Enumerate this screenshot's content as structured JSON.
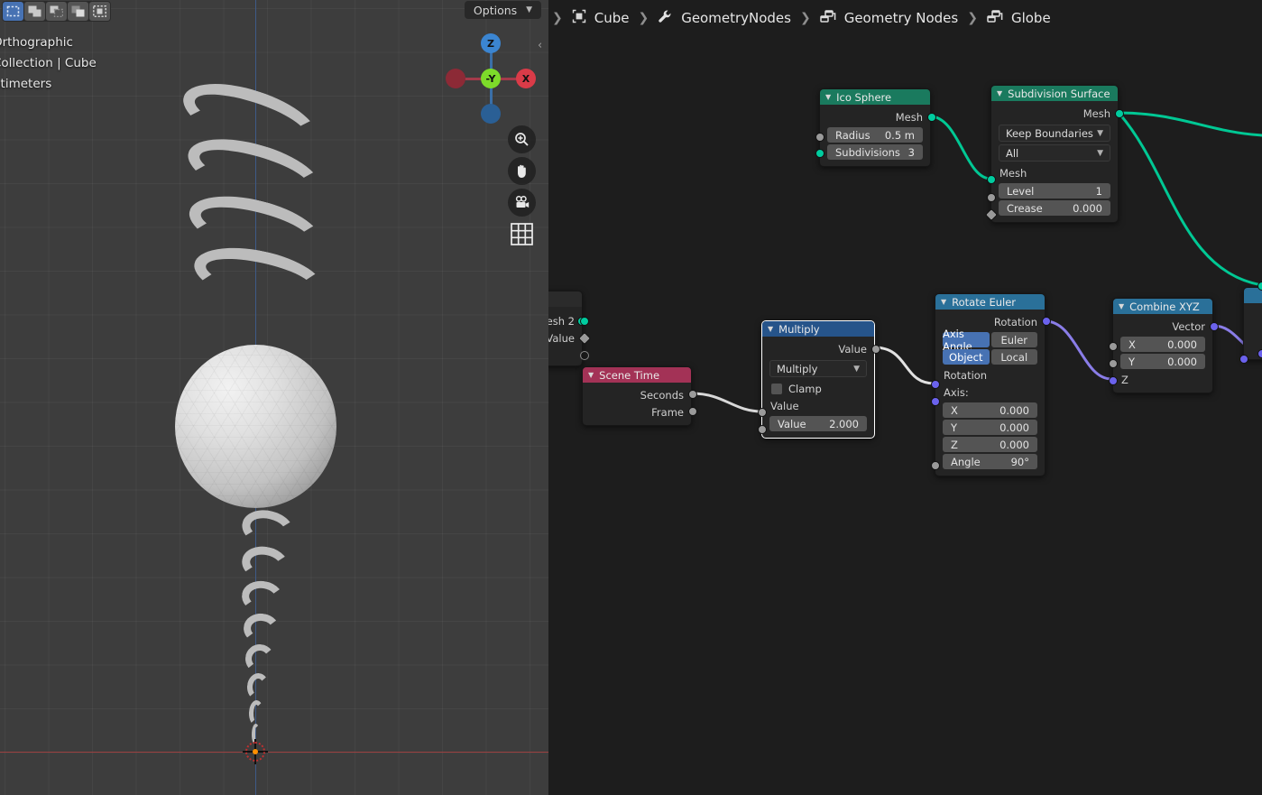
{
  "app": "Blender Geometry Nodes",
  "viewport": {
    "select_modes": [
      {
        "name": "set",
        "active": true
      },
      {
        "name": "extend",
        "active": false
      },
      {
        "name": "subtract",
        "active": false
      },
      {
        "name": "invert",
        "active": false
      },
      {
        "name": "intersect",
        "active": false
      }
    ],
    "options_label": "Options",
    "overlay": {
      "line1": "Orthographic",
      "line2": "Collection | Cube",
      "line3": "ntimeters"
    },
    "gizmo": {
      "z": "Z",
      "y": "-Y",
      "x": "X"
    },
    "tools": [
      {
        "name": "zoom-icon"
      },
      {
        "name": "pan-hand-icon"
      },
      {
        "name": "camera-icon"
      },
      {
        "name": "grid-icon"
      }
    ]
  },
  "breadcrumb": [
    {
      "icon": "object-icon",
      "label": "Cube"
    },
    {
      "icon": "modifier-wrench-icon",
      "label": "GeometryNodes"
    },
    {
      "icon": "nodetree-icon",
      "label": "Geometry Nodes"
    },
    {
      "icon": "nodetree-icon",
      "label": "Globe"
    }
  ],
  "node_editor": {
    "nodes": [
      {
        "id": "clipped-group",
        "title": "",
        "header_color": "#2b2b2b",
        "outputs": [
          {
            "label": "esh 2",
            "type": "geo"
          },
          {
            "label": "Value",
            "type": "diamond"
          },
          {
            "label": "",
            "type": "hollow"
          }
        ]
      },
      {
        "id": "ico-sphere",
        "title": "Ico Sphere",
        "header_color": "#1a7a5e",
        "outputs": [
          {
            "label": "Mesh",
            "type": "geo"
          }
        ],
        "fields": [
          {
            "label": "Radius",
            "value": "0.5 m",
            "socket": "val"
          },
          {
            "label": "Subdivisions",
            "value": "3",
            "socket": "geo"
          }
        ]
      },
      {
        "id": "subdivision-surface",
        "title": "Subdivision Surface",
        "header_color": "#1a7a5e",
        "outputs": [
          {
            "label": "Mesh",
            "type": "geo"
          }
        ],
        "dropdowns": [
          "Keep Boundaries",
          "All"
        ],
        "inputs": [
          {
            "label": "Mesh",
            "type": "geo"
          }
        ],
        "fields": [
          {
            "label": "Level",
            "value": "1",
            "socket": "val"
          },
          {
            "label": "Crease",
            "value": "0.000",
            "socket": "diamond"
          }
        ]
      },
      {
        "id": "scene-time",
        "title": "Scene Time",
        "header_color": "#a33256",
        "outputs": [
          {
            "label": "Seconds",
            "type": "val"
          },
          {
            "label": "Frame",
            "type": "val"
          }
        ]
      },
      {
        "id": "multiply",
        "title": "Multiply",
        "header_color": "#26548a",
        "selected": true,
        "outputs": [
          {
            "label": "Value",
            "type": "val"
          }
        ],
        "dropdowns": [
          "Multiply"
        ],
        "checkbox": {
          "label": "Clamp",
          "checked": false
        },
        "inputs": [
          {
            "label": "Value",
            "type": "val"
          }
        ],
        "fields": [
          {
            "label": "Value",
            "value": "2.000",
            "socket": "val"
          }
        ]
      },
      {
        "id": "rotate-euler",
        "title": "Rotate Euler",
        "header_color": "#2a7099",
        "outputs": [
          {
            "label": "Rotation",
            "type": "vec"
          }
        ],
        "toggles": [
          [
            {
              "label": "Axis Angle",
              "on": true
            },
            {
              "label": "Euler",
              "on": false
            }
          ],
          [
            {
              "label": "Object",
              "on": true
            },
            {
              "label": "Local",
              "on": false
            }
          ]
        ],
        "inputs": [
          {
            "label": "Rotation",
            "type": "vec"
          },
          {
            "label": "Axis:",
            "type": "vec"
          }
        ],
        "fields": [
          {
            "label": "X",
            "value": "0.000"
          },
          {
            "label": "Y",
            "value": "0.000"
          },
          {
            "label": "Z",
            "value": "0.000"
          },
          {
            "label": "Angle",
            "value": "90°",
            "socket": "val"
          }
        ]
      },
      {
        "id": "combine-xyz",
        "title": "Combine XYZ",
        "header_color": "#2a7099",
        "outputs": [
          {
            "label": "Vector",
            "type": "vec"
          }
        ],
        "fields": [
          {
            "label": "X",
            "value": "0.000",
            "socket": "val"
          },
          {
            "label": "Y",
            "value": "0.000",
            "socket": "val"
          }
        ],
        "inputs": [
          {
            "label": "Z",
            "type": "vec"
          }
        ]
      }
    ]
  },
  "colors": {
    "geometry_socket": "#00cc9f",
    "value_socket": "#9a9a9a",
    "vector_socket": "#6b62ed",
    "geometry_header": "#1a7a5e",
    "input_header": "#a33256",
    "converter_header": "#26548a",
    "vector_header": "#2a7099",
    "accent_blue": "#4772b3",
    "editor_bg": "#1d1d1d",
    "viewport_bg": "#3d3d3d"
  }
}
